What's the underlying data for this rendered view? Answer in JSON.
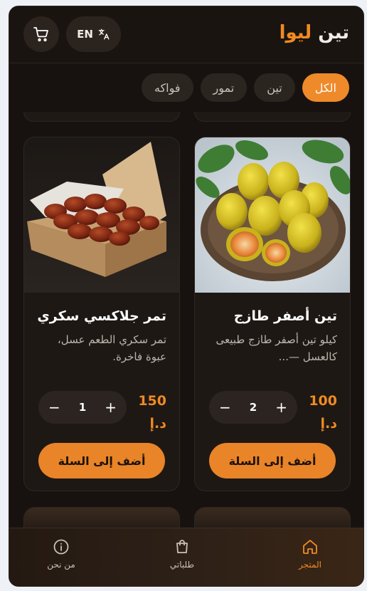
{
  "header": {
    "brand_part1": "تين",
    "brand_part2": "ليوا",
    "lang_label": "EN"
  },
  "tabs": [
    {
      "label": "الكل",
      "active": true
    },
    {
      "label": "تين",
      "active": false
    },
    {
      "label": "تمور",
      "active": false
    },
    {
      "label": "فواكه",
      "active": false
    }
  ],
  "products": [
    {
      "title": "تين أصفر طازج",
      "description": "كيلو تين أصفر طازج طبيعى كالعسل —...",
      "price": "100",
      "currency": "د.إ",
      "quantity": "2",
      "add_label": "أضف إلى السلة"
    },
    {
      "title": "تمر جلاكسي سكري",
      "description": "تمر سكري الطعم عسل، عبوة فاخرة.",
      "price": "150",
      "currency": "د.إ",
      "quantity": "1",
      "add_label": "أضف إلى السلة"
    }
  ],
  "bottom_nav": {
    "store": "المتجر",
    "orders": "طلباتي",
    "about": "من نحن"
  },
  "colors": {
    "accent": "#f08a23",
    "background": "#17120f",
    "card": "#1e1814"
  }
}
